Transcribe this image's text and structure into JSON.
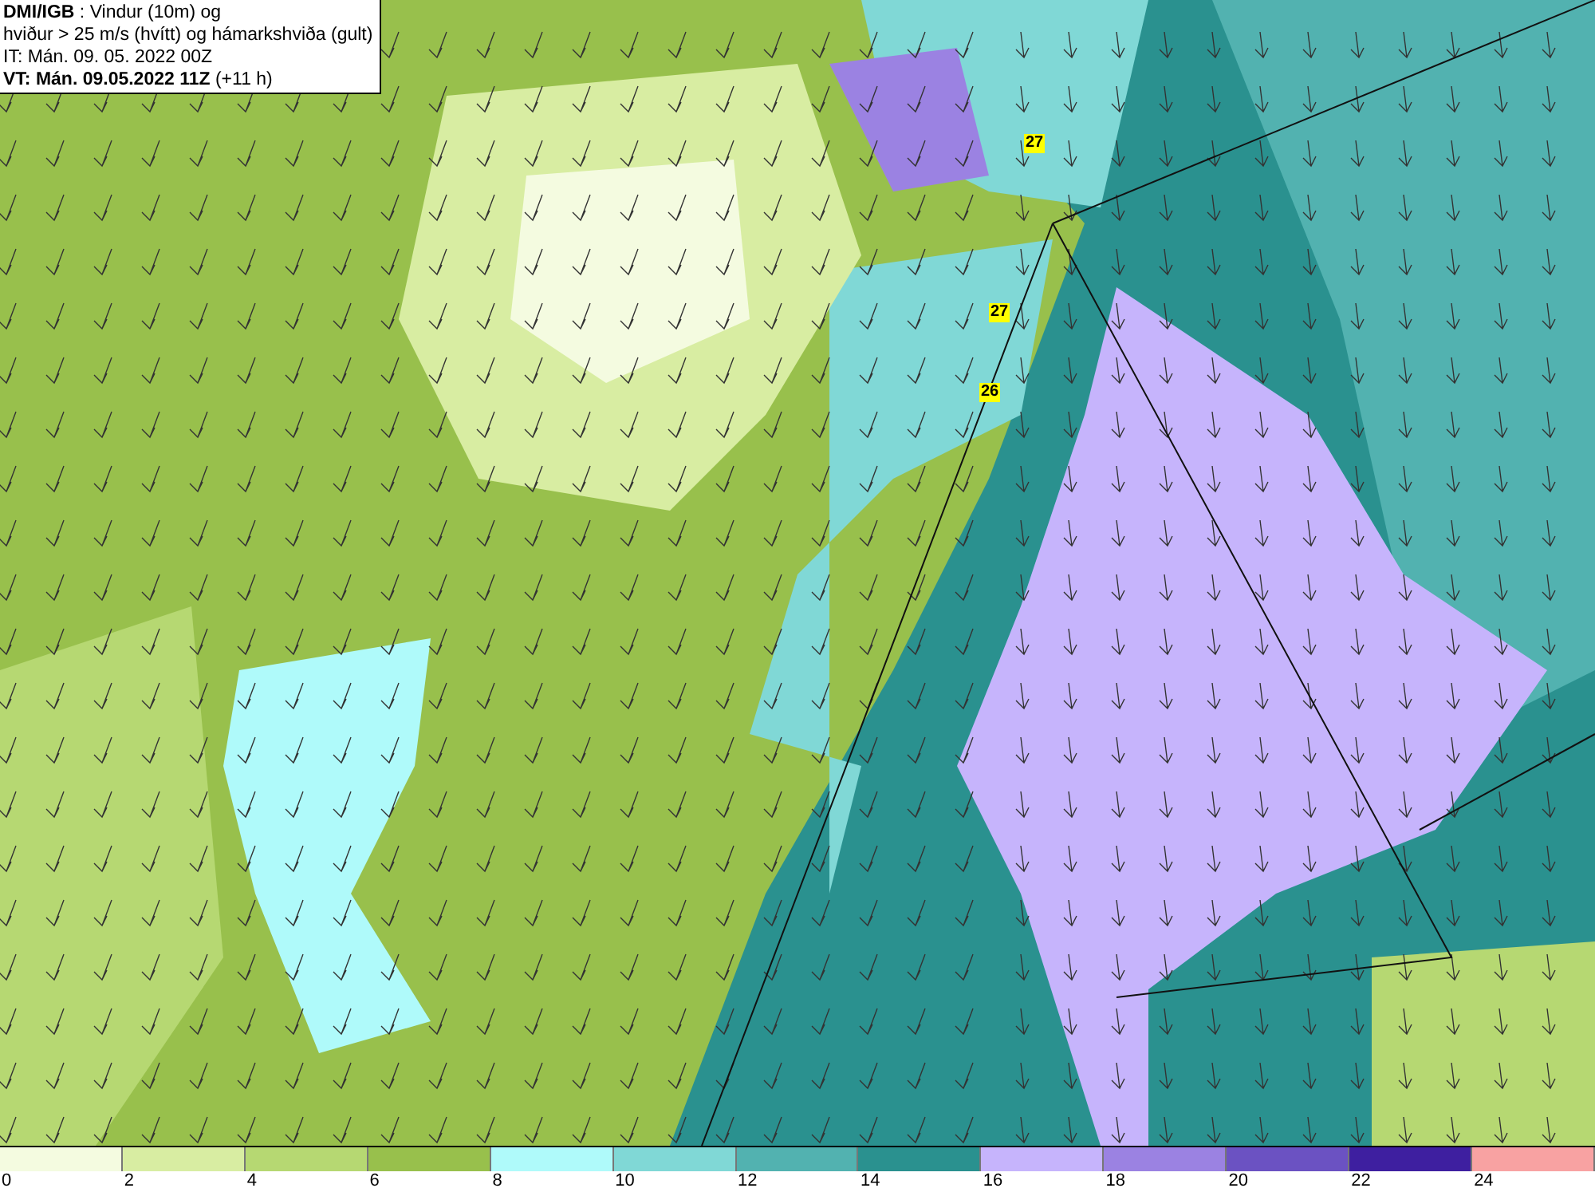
{
  "header": {
    "lines": [
      "**DMI/IGB** : Vindur (10m) og",
      "hviður > 25 m/s (hvítt) og hámarkshviða (gult)",
      "IT: Mán. 09. 05. 2022 00Z",
      "**VT: Mán. 09.05.2022 11Z** (+11 h)"
    ]
  },
  "map": {
    "gust_labels": [
      "27",
      "27",
      "26"
    ]
  },
  "legend": {
    "segments": [
      {
        "color": "#f4fbe0"
      },
      {
        "color": "#d8eda2"
      },
      {
        "color": "#b6d872"
      },
      {
        "color": "#98c04c"
      },
      {
        "color": "#affafa"
      },
      {
        "color": "#80d8d6"
      },
      {
        "color": "#52b2b0"
      },
      {
        "color": "#2a918f"
      },
      {
        "color": "#c6b4fc"
      },
      {
        "color": "#9b82e2"
      },
      {
        "color": "#6b52c2"
      },
      {
        "color": "#3e1fa0"
      },
      {
        "color": "#f8a2a2"
      }
    ],
    "ticks": [
      "0",
      "2",
      "4",
      "6",
      "8",
      "10",
      "12",
      "14",
      "16",
      "18",
      "20",
      "22",
      "24"
    ]
  }
}
